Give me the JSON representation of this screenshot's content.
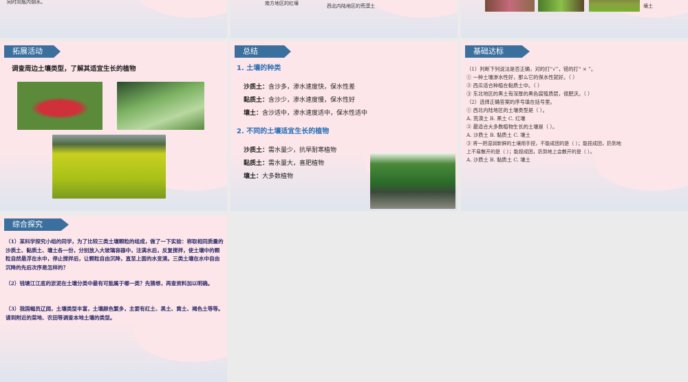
{
  "row1": {
    "slide1": {
      "line1": "同时向瓶内倒水。"
    },
    "slide2": {
      "cap_red": "南方地区的红壤",
      "cap_desert": "西北内陆地区的荒漠土"
    },
    "slide3": {
      "label": "壤土"
    }
  },
  "expand": {
    "tag": "拓展活动",
    "heading": "调查周边土壤类型，了解其适宜生长的植物"
  },
  "summary": {
    "tag": "总结",
    "h1": "1. 土壤的种类",
    "types": [
      {
        "k": "沙质土：",
        "v": "含沙多，渗水速度快，保水性差"
      },
      {
        "k": "黏质土：",
        "v": "含沙少，渗水速度慢，保水性好"
      },
      {
        "k": "壤土：",
        "v": "含沙适中，渗水速度适中，保水性适中"
      }
    ],
    "h2": "2. 不同的土壤适宜生长的植物",
    "plants": [
      {
        "k": "沙质土：",
        "v": "需水量少，抗旱耐寒植物"
      },
      {
        "k": "黏质土：",
        "v": "需水量大，喜肥植物"
      },
      {
        "k": "壤土：",
        "v": "大多数植物"
      }
    ]
  },
  "basic": {
    "tag": "基础达标",
    "lines": [
      "（1）判断下列说法是否正确，对的打“√”，错的打“  ×  ”。",
      "① 一种土壤渗水性好，那么它的保水性就好。（     ）",
      "② 西瓜适合种植在黏质土中。（     ）",
      "③ 东北地区的黑土有深厚的黑色腐殖质层，很肥沃。（     ）",
      "（2）选择正确答案的序号填在括号里。",
      "① 西北内陆地区的土壤类型是（     ）。",
      "A. 荒漠土       B. 黑土       C. 红壤",
      "② 最适合大多数植物生长的土壤是（     ）。",
      "A. 沙质土           B. 黏质土           C. 壤土",
      "③ 将一把湿润新鲜的土壤用手捏，不能成团的是（     ）；能捏成团，扔到地",
      "上不易散开的是（     ）；能捏成团，扔到地上会散开的是（     ）。",
      "A. 沙质土           B. 黏质土           C. 壤土"
    ]
  },
  "explore": {
    "tag": "综合探究",
    "paras": [
      "（1）某科学探究小组的同学，为了比较三类土壤颗粒的组成，做了一下实验：称取相同质量的沙质土、黏质土、壤土各一份，分别放入大玻璃容器中，注满水后，反复搅拌，使土壤中的颗粒自然悬浮在水中，停止搅拌后，让颗粒自由沉降，直至上面的水变清。三类土壤在水中自由沉降的先后次序是怎样的？",
      "（2）钱塘江江底的淤泥在土壤分类中最有可能属于哪一类？先猜想，再查资料加以明确。",
      "（3）我国幅员辽阔，土壤类型丰富，土壤颜色繁多，主要有红土、黑土、黄土、褐色土等等。请到附近的菜地、农田等调查本地土壤的类型。"
    ]
  }
}
